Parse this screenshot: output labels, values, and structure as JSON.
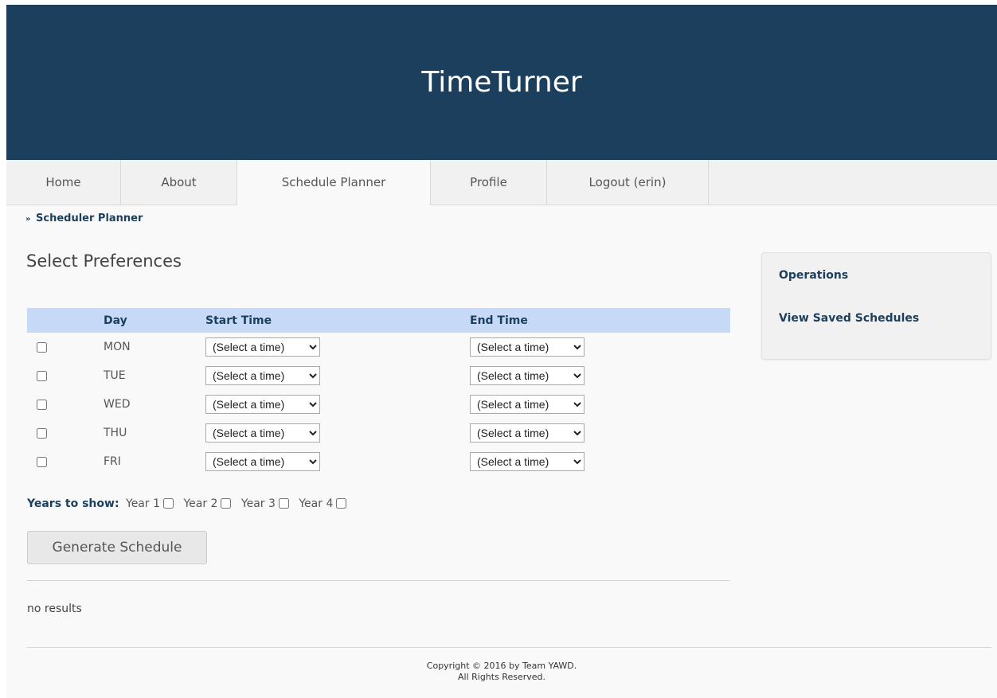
{
  "site": {
    "title": "TimeTurner"
  },
  "nav": {
    "tabs": [
      {
        "label": "Home",
        "active": false
      },
      {
        "label": "About",
        "active": false
      },
      {
        "label": "Schedule Planner",
        "active": true
      },
      {
        "label": "Profile",
        "active": false
      },
      {
        "label": "Logout (erin)",
        "active": false
      }
    ]
  },
  "breadcrumb": {
    "separator": "»",
    "label": "Scheduler Planner"
  },
  "main": {
    "section_title": "Select Preferences",
    "table": {
      "headers": [
        "",
        "Day",
        "Start Time",
        "End Time"
      ],
      "rows": [
        {
          "day": "MON",
          "checked": false,
          "start": "(Select a time)",
          "end": "(Select a time)"
        },
        {
          "day": "TUE",
          "checked": false,
          "start": "(Select a time)",
          "end": "(Select a time)"
        },
        {
          "day": "WED",
          "checked": false,
          "start": "(Select a time)",
          "end": "(Select a time)"
        },
        {
          "day": "THU",
          "checked": false,
          "start": "(Select a time)",
          "end": "(Select a time)"
        },
        {
          "day": "FRI",
          "checked": false,
          "start": "(Select a time)",
          "end": "(Select a time)"
        }
      ]
    },
    "years": {
      "label": "Years to show:",
      "items": [
        {
          "label": "Year 1",
          "checked": false
        },
        {
          "label": "Year 2",
          "checked": false
        },
        {
          "label": "Year 3",
          "checked": false
        },
        {
          "label": "Year 4",
          "checked": false
        }
      ]
    },
    "generate_label": "Generate Schedule",
    "results_text": "no results"
  },
  "operations": {
    "title": "Operations",
    "link_label": "View Saved Schedules"
  },
  "footer": {
    "line1": "Copyright © 2016 by Team YAWD.",
    "line2": "All Rights Reserved."
  },
  "colors": {
    "banner": "#1c3f5d",
    "table_header": "#c6daf8",
    "accent_text": "#1c3f5d"
  }
}
